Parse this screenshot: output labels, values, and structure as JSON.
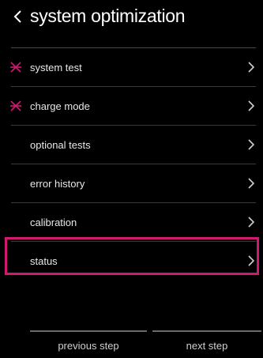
{
  "header": {
    "title": "system optimization",
    "back_icon": "chevron-left-icon"
  },
  "menu": {
    "items": [
      {
        "label": "system test",
        "required": true
      },
      {
        "label": "charge mode",
        "required": true
      },
      {
        "label": "optional tests",
        "required": false
      },
      {
        "label": "error history",
        "required": false
      },
      {
        "label": "calibration",
        "required": false
      },
      {
        "label": "status",
        "required": false,
        "selected": true
      }
    ],
    "required_marker_icon": "asterisk-icon",
    "item_chevron_icon": "chevron-right-icon"
  },
  "footer": {
    "previous_label": "previous step",
    "next_label": "next step"
  },
  "colors": {
    "background": "#000000",
    "accent": "#d01a72",
    "text": "#ffffff",
    "divider": "#3a3a3a"
  }
}
